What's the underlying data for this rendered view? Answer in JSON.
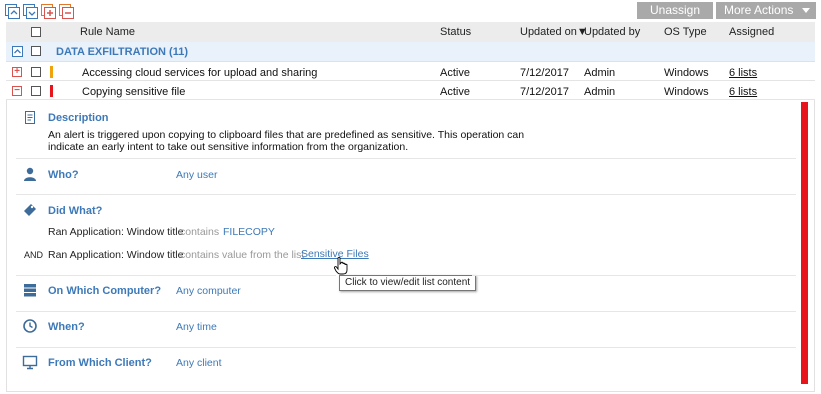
{
  "toolbar": {
    "icons": [
      "collapse-all-icon",
      "expand-all-icon",
      "add-rule-icon",
      "remove-rule-icon"
    ],
    "unassign_label": "Unassign",
    "more_actions_label": "More Actions"
  },
  "table": {
    "columns": {
      "rule_name": "Rule Name",
      "status": "Status",
      "updated_on": "Updated on",
      "updated_by": "Updated by",
      "os_type": "OS Type",
      "assigned": "Assigned"
    },
    "sort_indicator": "▼",
    "group": {
      "title": "DATA EXFILTRATION (11)"
    },
    "rows": [
      {
        "name": "Accessing cloud services for upload and sharing",
        "status": "Active",
        "updated_on": "7/12/2017",
        "updated_by": "Admin",
        "os_type": "Windows",
        "assigned": "6 lists",
        "severity_color": "#f0a30a",
        "expander": "+"
      },
      {
        "name": "Copying sensitive file",
        "status": "Active",
        "updated_on": "7/12/2017",
        "updated_by": "Admin",
        "os_type": "Windows",
        "assigned": "6 lists",
        "severity_color": "#e8141b",
        "expander": "−"
      }
    ]
  },
  "detail": {
    "description": {
      "title": "Description",
      "text": "An alert is triggered upon copying to clipboard files that are predefined as sensitive. This operation can indicate an early intent to take out sensitive information from the organization."
    },
    "who": {
      "title": "Who?",
      "value": "Any user"
    },
    "did_what": {
      "title": "Did What?",
      "conditions": [
        {
          "prefix": "",
          "label": "Ran Application: Window title",
          "operator": "contains",
          "value": "FILECOPY"
        },
        {
          "prefix": "AND",
          "label": "Ran Application: Window title",
          "operator": "contains value from the list",
          "value": "Sensitive Files"
        }
      ]
    },
    "computer": {
      "title": "On Which Computer?",
      "value": "Any computer"
    },
    "when": {
      "title": "When?",
      "value": "Any time"
    },
    "client": {
      "title": "From Which Client?",
      "value": "Any client"
    },
    "tooltip": "Click to view/edit list content",
    "severity_color": "#e8141b"
  }
}
